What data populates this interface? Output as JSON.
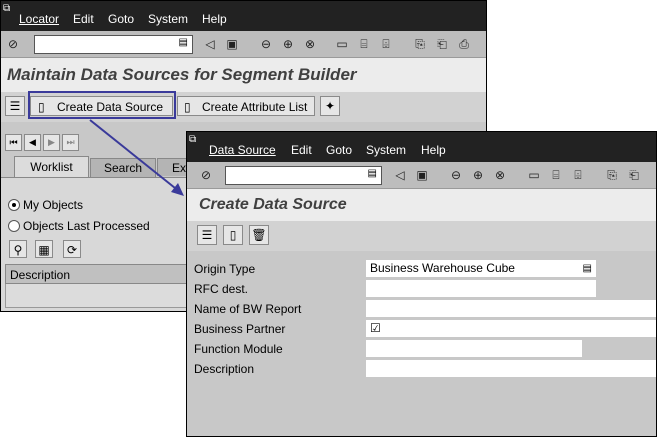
{
  "back": {
    "menu": [
      "Locator",
      "Edit",
      "Goto",
      "System",
      "Help"
    ],
    "title": "Maintain Data Sources for Segment Builder",
    "buttons": {
      "create_ds": "Create Data Source",
      "create_attr": "Create Attribute List"
    },
    "tabs": [
      "Worklist",
      "Search",
      "Ex"
    ],
    "radios": [
      "My Objects",
      "Objects Last Processed"
    ],
    "table_header": "Description"
  },
  "front": {
    "menu": [
      "Data Source",
      "Edit",
      "Goto",
      "System",
      "Help"
    ],
    "title": "Create Data Source",
    "rows": [
      {
        "label": "Origin Type",
        "value": "Business Warehouse Cube"
      },
      {
        "label": "RFC dest.",
        "value": ""
      },
      {
        "label": "Name of BW Report",
        "value": ""
      },
      {
        "label": "Business Partner",
        "value": "☑"
      },
      {
        "label": "Function Module",
        "value": ""
      },
      {
        "label": "Description",
        "value": ""
      }
    ]
  },
  "colors": {
    "highlight": "#3a3a9a",
    "menubar": "#222222"
  }
}
